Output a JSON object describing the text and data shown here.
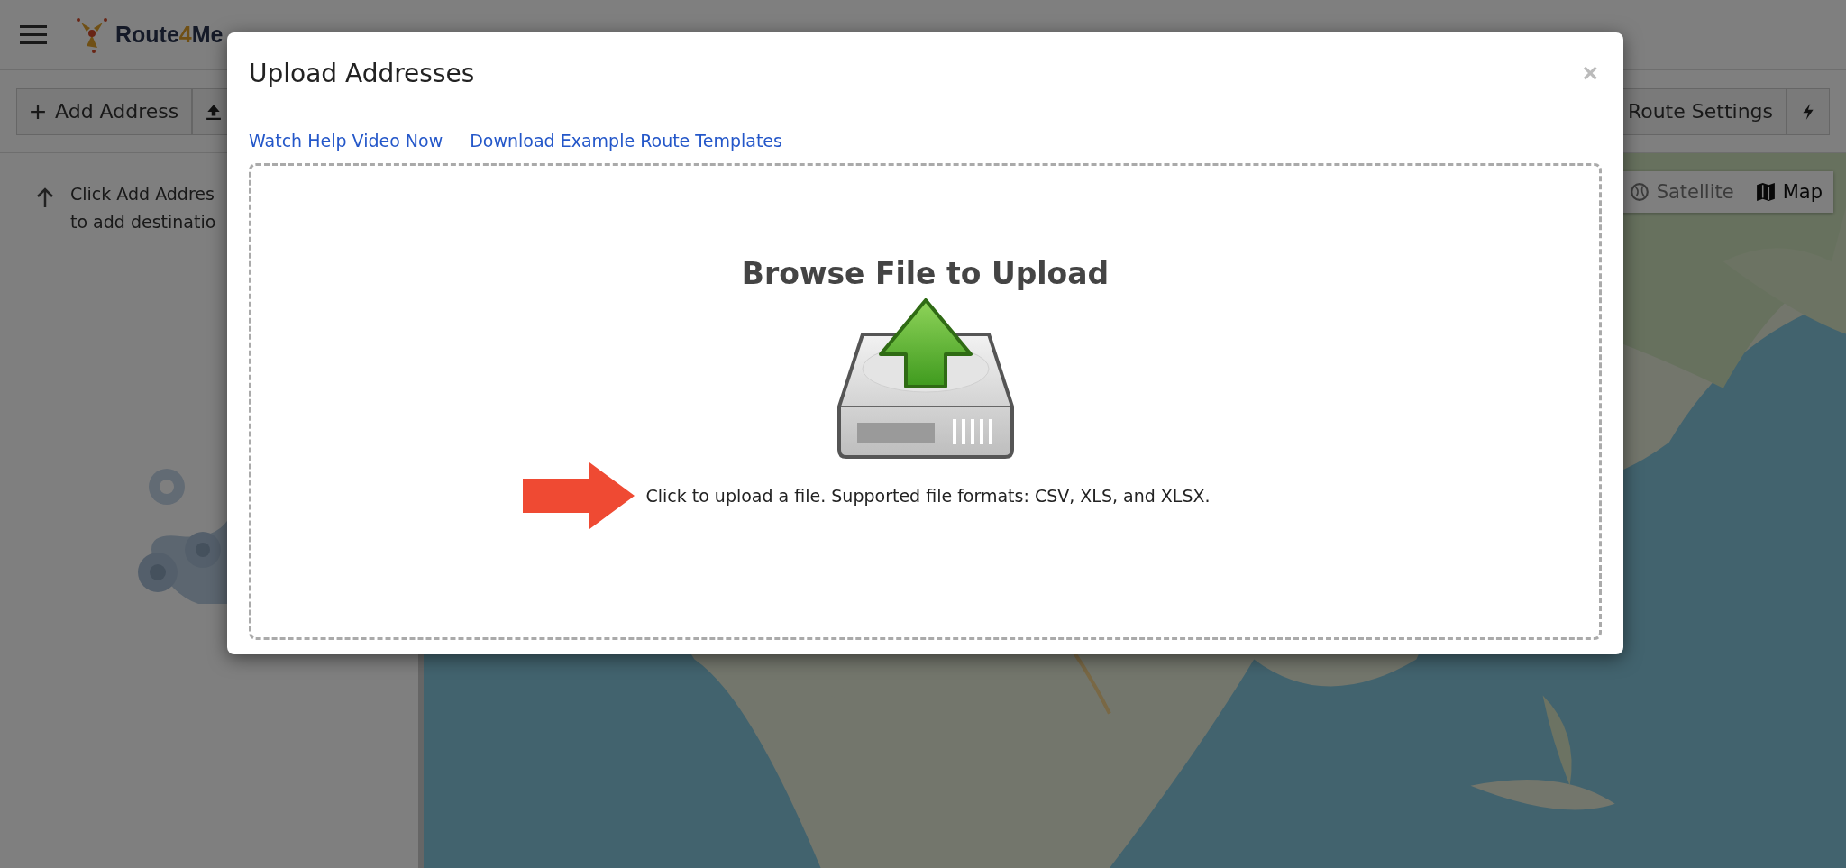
{
  "header": {
    "logo": {
      "name": "Route",
      "accent": "4",
      "suffix": "Me"
    }
  },
  "toolbar": {
    "add_button": "Add Address",
    "settings_button": "Route Settings"
  },
  "sidebar": {
    "hint_lines": [
      "Click Add Addres",
      "to add destinatio"
    ]
  },
  "map": {
    "type_toggle": [
      {
        "label": "Satellite",
        "selected": false
      },
      {
        "label": "Map",
        "selected": true
      }
    ]
  },
  "modal": {
    "title": "Upload Addresses",
    "close": "×",
    "links": [
      "Watch Help Video Now",
      "Download Example Route Templates"
    ],
    "dropzone": {
      "title": "Browse File to Upload",
      "text": "Click to upload a file. Supported file formats: CSV, XLS, and XLSX."
    }
  }
}
